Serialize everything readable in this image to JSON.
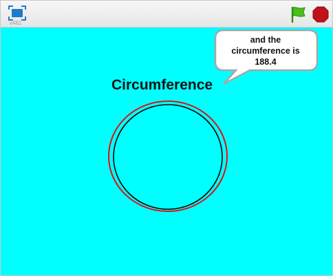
{
  "player": {
    "version": "v461",
    "buttons": {
      "fullscreen_icon": "fullscreen-icon",
      "green_flag_icon": "green-flag-icon",
      "stop_icon": "stop-icon"
    }
  },
  "stage": {
    "background_color": "#00ffff",
    "title": "Circumference",
    "speech_bubble": {
      "line1": "and the",
      "line2": "circumference is",
      "line3": "188.4"
    },
    "circles": {
      "outer_color": "#dd1111",
      "inner_color": "#000000"
    }
  },
  "colors": {
    "flag_green": "#4cbf1c",
    "stop_red": "#c0121b",
    "fullscreen_blue": "#1f7acb"
  }
}
